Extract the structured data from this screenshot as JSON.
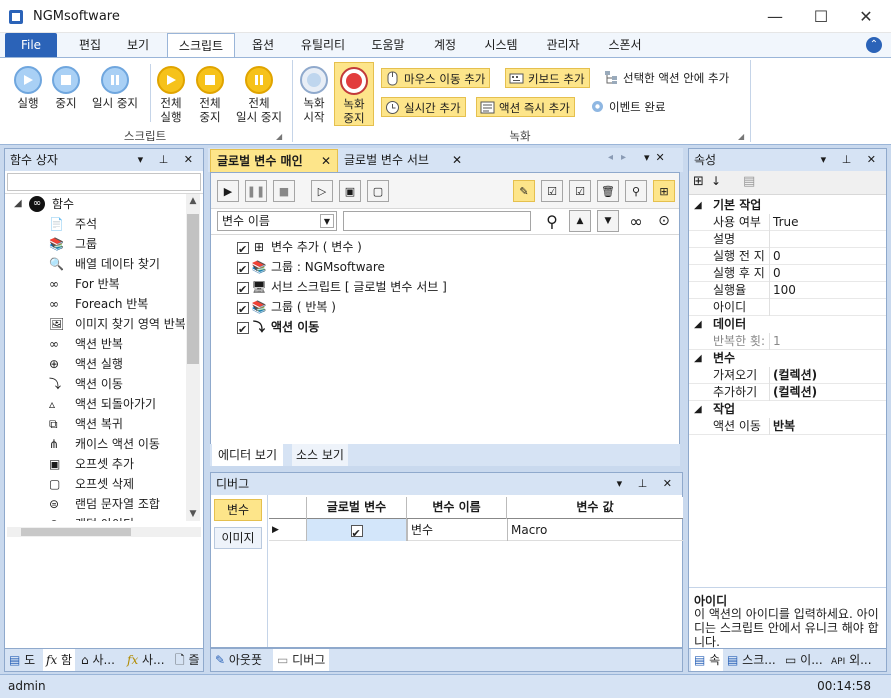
{
  "app": {
    "title": "NGMsoftware"
  },
  "window_controls": {
    "minimize": "—",
    "maximize": "☐",
    "close": "✕"
  },
  "ribbon_tabs": [
    "File",
    "편집",
    "보기",
    "스크립트",
    "옵션",
    "유틸리티",
    "도움말",
    "계정",
    "시스템",
    "관리자",
    "스폰서"
  ],
  "ribbon": {
    "script_group": {
      "label": "스크립트",
      "run": "실행",
      "stop": "중지",
      "pause": "일시 중지",
      "run_all_1": "전체",
      "run_all_2": "실행",
      "stop_all_1": "전체",
      "stop_all_2": "중지",
      "pause_all_1": "전체",
      "pause_all_2": "일시 중지"
    },
    "record_group": {
      "label": "녹화",
      "record_start_1": "녹화",
      "record_start_2": "시작",
      "record_stop_1": "녹화",
      "record_stop_2": "중지",
      "add_mouse_move": "마우스 이동 추가",
      "add_keyboard": "키보드 추가",
      "add_in_selected": "선택한 액션 안에 추가",
      "add_realtime": "실시간 추가",
      "add_action_now": "액션 즉시 추가",
      "event_done": "이벤트 완료"
    }
  },
  "left_panel": {
    "title": "함수 상자",
    "root": "함수",
    "items": [
      "주석",
      "그룹",
      "배열 데이타 찾기",
      "For 반복",
      "Foreach 반복",
      "이미지 찾기 영역 반복",
      "액션 반복",
      "액션 실행",
      "액션 이동",
      "액션 되돌아가기",
      "액션 복귀",
      "캐이스 액션 이동",
      "오프셋 추가",
      "오프셋 삭제",
      "랜덤 문자열 조합",
      "랜덤 아이디"
    ],
    "bottom_tabs": [
      "도",
      "함",
      "사...",
      "사...",
      "즐"
    ]
  },
  "doc_tabs": {
    "active": "글로벌 변수 매인",
    "second": "글로벌 변수 서브"
  },
  "editor": {
    "dropdown_value": "변수 이름",
    "search_value": "",
    "nodes": [
      "변수 추가 ( 변수 )",
      "그룹 : NGMsoftware",
      "서브 스크립트 [ 글로벌 변수 서브 ]",
      "그룹 ( 반복 )",
      "액션 이동"
    ],
    "bottom_tabs": [
      "에디터 보기",
      "소스 보기"
    ]
  },
  "debug": {
    "title": "디버그",
    "side_tabs": [
      "변수",
      "이미지"
    ],
    "columns": [
      "글로벌 변수",
      "변수 이름",
      "변수 값"
    ],
    "rows": [
      {
        "global": true,
        "name": "변수",
        "value": "Macro"
      }
    ],
    "bottom_tabs": [
      "아웃풋",
      "디버그"
    ]
  },
  "properties": {
    "title": "속성",
    "categories": [
      {
        "name": "기본 작업",
        "rows": [
          [
            "사용 여부",
            "True"
          ],
          [
            "설명",
            ""
          ],
          [
            "실행 전 지",
            "0"
          ],
          [
            "실행 후 지",
            "0"
          ],
          [
            "실행율",
            "100"
          ],
          [
            "아이디",
            ""
          ]
        ]
      },
      {
        "name": "데이터",
        "rows": [
          [
            "반복한 횟:",
            "1"
          ]
        ]
      },
      {
        "name": "변수",
        "rows": [
          [
            "가져오기",
            "(컬렉션)"
          ],
          [
            "추가하기",
            "(컬렉션)"
          ]
        ]
      },
      {
        "name": "작업",
        "rows": [
          [
            "액션 이동",
            "반복"
          ]
        ]
      }
    ],
    "help_title": "아이디",
    "help_text": "이 액션의 아이디를 입력하세요. 아이디는 스크립트 안에서 유니크 해야 합니다.",
    "bottom_tabs": [
      "속",
      "스크...",
      "이...",
      "외..."
    ]
  },
  "status": {
    "user": "admin",
    "time": "00:14:58"
  }
}
